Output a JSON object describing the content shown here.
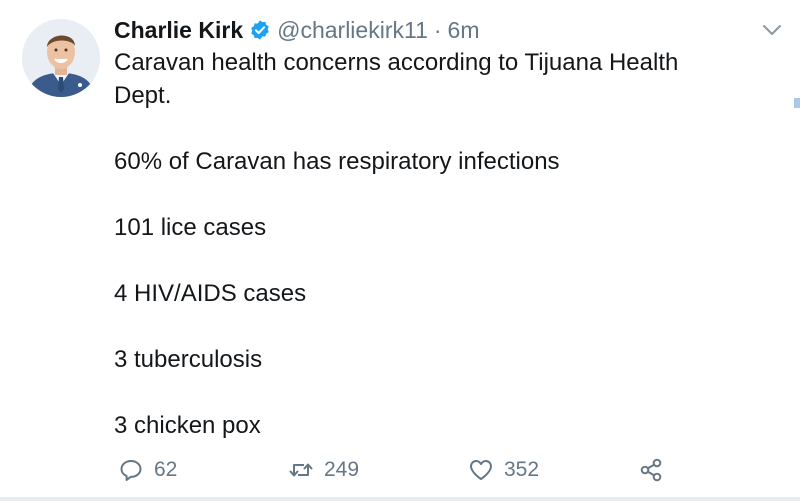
{
  "tweet": {
    "author": {
      "name": "Charlie Kirk",
      "handle": "@charliekirk11",
      "verified": true
    },
    "separator": "·",
    "time": "6m",
    "text_lines": [
      "Caravan health concerns according to Tijuana Health",
      "Dept.",
      "",
      "60% of Caravan has respiratory infections",
      "",
      "101 lice cases",
      "",
      "4 HIV/AIDS cases",
      "",
      "3 tuberculosis",
      "",
      "3 chicken pox"
    ],
    "actions": {
      "reply_count": "62",
      "retweet_count": "249",
      "like_count": "352"
    }
  },
  "colors": {
    "text": "#14171a",
    "muted": "#657786",
    "verified": "#1da1f2",
    "background": "#ffffff"
  },
  "icons": {
    "avatar": "avatar-image",
    "verified": "verified-badge-icon",
    "caret": "chevron-down-icon",
    "reply": "reply-icon",
    "retweet": "retweet-icon",
    "like": "heart-icon",
    "share": "share-icon"
  }
}
